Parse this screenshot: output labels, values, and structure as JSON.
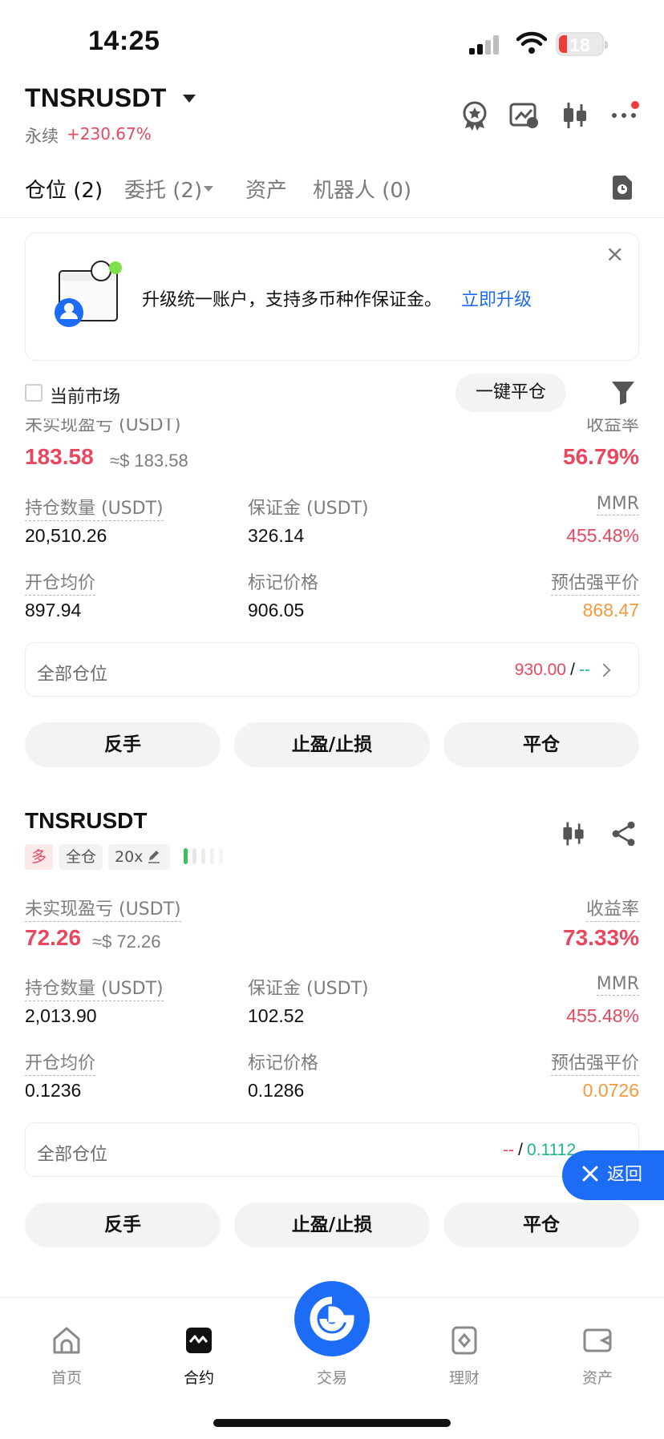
{
  "status_bar": {
    "time": "14:25",
    "battery": "18"
  },
  "header": {
    "pair": "TNSRUSDT",
    "contract_type": "永续",
    "change": "+230.67%"
  },
  "tabs": [
    {
      "label": "仓位 (2)"
    },
    {
      "label": "委托 (2)"
    },
    {
      "label": "资产"
    },
    {
      "label": "机器人 (0)"
    }
  ],
  "banner": {
    "text": "升级统一账户，支持多币种作保证金。",
    "link": "立即升级",
    "close": "×"
  },
  "filter": {
    "current_market_label": "当前市场",
    "close_all_label": "一键平仓"
  },
  "position1": {
    "pnl_label": "未实现盈亏 (USDT)",
    "roe_label": "收益率",
    "pnl": "183.58",
    "pnl_approx": "≈$ 183.58",
    "roe": "56.79%",
    "size_label": "持仓数量 (USDT)",
    "margin_label": "保证金 (USDT)",
    "mmr_label": "MMR",
    "size": "20,510.26",
    "margin": "326.14",
    "mmr": "455.48%",
    "entry_label": "开仓均价",
    "mark_label": "标记价格",
    "liq_label": "预估强平价",
    "entry": "897.94",
    "mark": "906.05",
    "liq": "868.47",
    "all_label": "全部仓位",
    "tp": "930.00",
    "sep": "/",
    "sl": "--",
    "buttons": [
      "反手",
      "止盈/止损",
      "平仓"
    ]
  },
  "position2": {
    "pair": "TNSRUSDT",
    "side": "多",
    "margin_mode": "全仓",
    "leverage": "20x",
    "pnl_label": "未实现盈亏 (USDT)",
    "roe_label": "收益率",
    "pnl": "72.26",
    "pnl_approx": "≈$ 72.26",
    "roe": "73.33%",
    "size_label": "持仓数量 (USDT)",
    "margin_label": "保证金 (USDT)",
    "mmr_label": "MMR",
    "size": "2,013.90",
    "margin": "102.52",
    "mmr": "455.48%",
    "entry_label": "开仓均价",
    "mark_label": "标记价格",
    "liq_label": "预估强平价",
    "entry": "0.1236",
    "mark": "0.1286",
    "liq": "0.0726",
    "all_label": "全部仓位",
    "tp": "--",
    "sep": "/",
    "sl": "0.1112",
    "buttons": [
      "反手",
      "止盈/止损",
      "平仓"
    ]
  },
  "return_button": "返回",
  "bottom_nav": [
    {
      "label": "首页"
    },
    {
      "label": "合约"
    },
    {
      "label": "交易"
    },
    {
      "label": "理财"
    },
    {
      "label": "资产"
    }
  ],
  "colors": {
    "accent": "#1c6cf5",
    "loss_red": "#e8485f",
    "liq_orange": "#f29a3c",
    "profit_green": "#1fb58e"
  }
}
